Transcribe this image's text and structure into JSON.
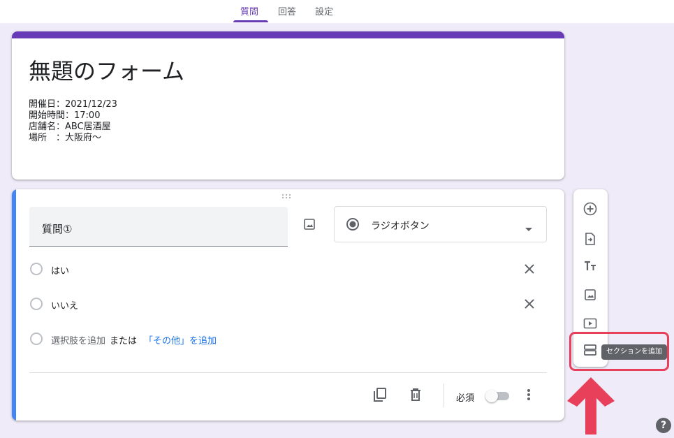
{
  "tabs": [
    {
      "label": "質問",
      "active": true
    },
    {
      "label": "回答",
      "active": false
    },
    {
      "label": "設定",
      "active": false
    }
  ],
  "form": {
    "title": "無題のフォーム",
    "description_lines": [
      "開催日：2021/12/23",
      "開始時間：17:00",
      "店舗名：ABC居酒屋",
      "場所　：大阪府〜"
    ]
  },
  "question": {
    "title": "質問①",
    "type_label": "ラジオボタン",
    "options": [
      "はい",
      "いいえ"
    ],
    "add_option_label": "選択肢を追加",
    "or_label": "または",
    "add_other_label": "「その他」を追加",
    "required_label": "必須",
    "required": false
  },
  "toolbar": {
    "items": [
      {
        "icon": "add-question-icon"
      },
      {
        "icon": "import-questions-icon"
      },
      {
        "icon": "add-title-icon"
      },
      {
        "icon": "add-image-icon"
      },
      {
        "icon": "add-video-icon"
      },
      {
        "icon": "add-section-icon"
      }
    ],
    "tooltip": "セクションを追加"
  },
  "colors": {
    "theme": "#673ab7",
    "canvas": "#f0ebf8",
    "active_question_bar": "#4285f4",
    "highlight": "#e8405a",
    "link": "#1a73e8"
  },
  "help_label": "?"
}
